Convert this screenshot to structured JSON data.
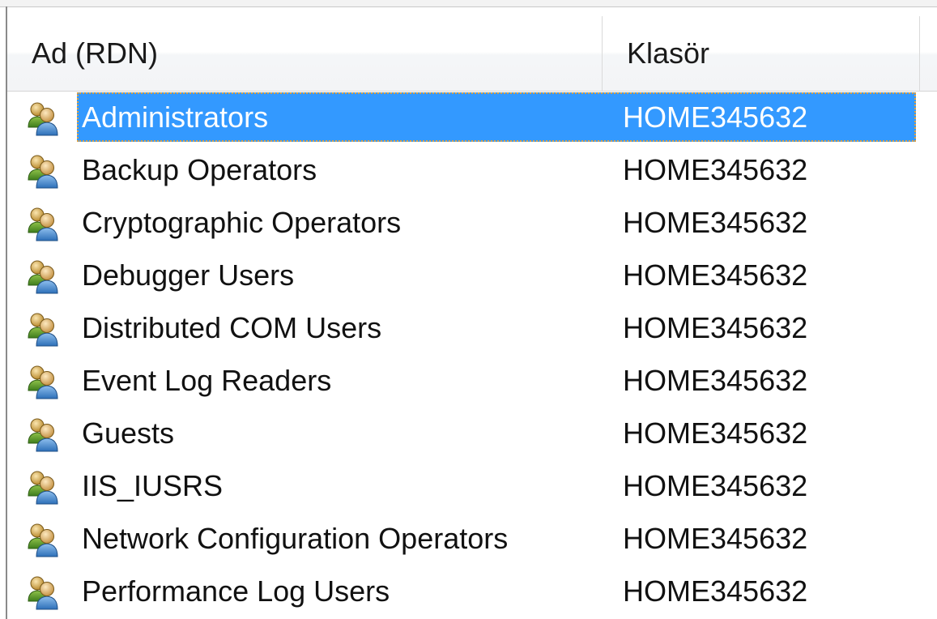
{
  "columns": {
    "name": "Ad (RDN)",
    "folder": "Klasör"
  },
  "rows": [
    {
      "name": "Administrators",
      "folder": "HOME345632",
      "selected": true,
      "icon": "user-group-icon"
    },
    {
      "name": "Backup Operators",
      "folder": "HOME345632",
      "selected": false,
      "icon": "user-group-icon"
    },
    {
      "name": "Cryptographic Operators",
      "folder": "HOME345632",
      "selected": false,
      "icon": "user-group-icon"
    },
    {
      "name": "Debugger Users",
      "folder": "HOME345632",
      "selected": false,
      "icon": "user-group-icon"
    },
    {
      "name": "Distributed COM Users",
      "folder": "HOME345632",
      "selected": false,
      "icon": "user-group-icon"
    },
    {
      "name": "Event Log Readers",
      "folder": "HOME345632",
      "selected": false,
      "icon": "user-group-icon"
    },
    {
      "name": "Guests",
      "folder": "HOME345632",
      "selected": false,
      "icon": "user-group-icon"
    },
    {
      "name": "IIS_IUSRS",
      "folder": "HOME345632",
      "selected": false,
      "icon": "user-group-icon"
    },
    {
      "name": "Network Configuration Operators",
      "folder": "HOME345632",
      "selected": false,
      "icon": "user-group-icon"
    },
    {
      "name": "Performance Log Users",
      "folder": "HOME345632",
      "selected": false,
      "icon": "user-group-icon"
    }
  ],
  "colors": {
    "selection": "#3399ff",
    "focus_outline": "#e0a040"
  }
}
